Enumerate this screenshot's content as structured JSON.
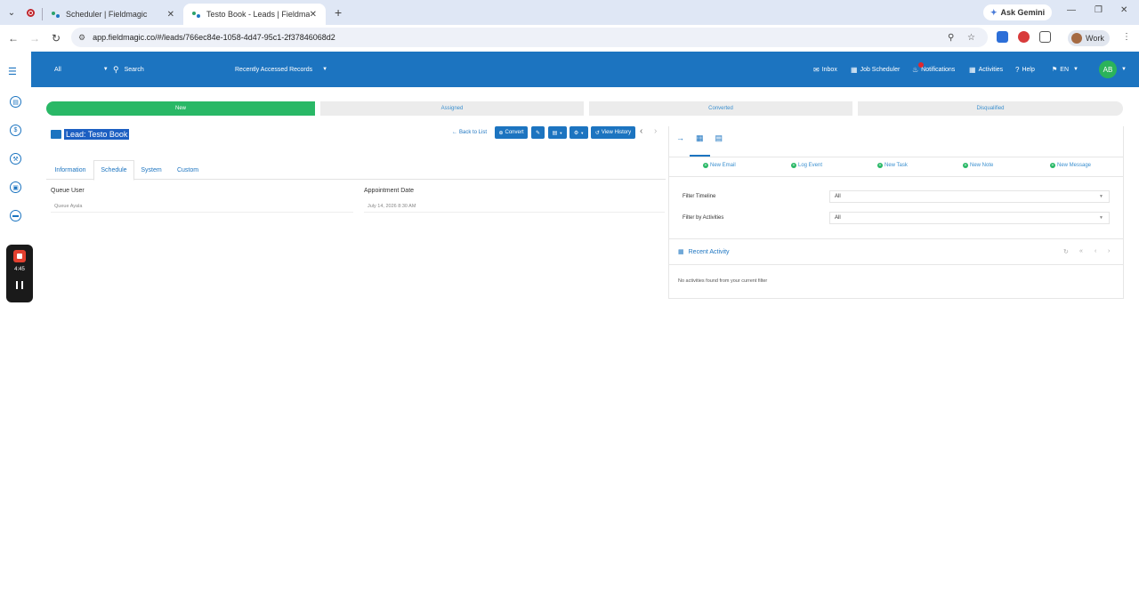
{
  "browser": {
    "tabs": [
      {
        "title": "Scheduler | Fieldmagic",
        "active": false
      },
      {
        "title": "Testo Book - Leads | Fieldmagic",
        "active": true
      }
    ],
    "new_tab": "+",
    "ask_gemini": "Ask Gemini",
    "url": "app.fieldmagic.co/#/leads/766ec84e-1058-4d47-95c1-2f37846068d2",
    "profile": "Work"
  },
  "header": {
    "scope": "All",
    "search": "Search",
    "recent_records": "Recently Accessed Records",
    "inbox": "Inbox",
    "job_scheduler": "Job Scheduler",
    "notifications": "Notifications",
    "notifications_count": "1",
    "activities": "Activities",
    "help": "Help",
    "language": "EN",
    "avatar": "AB"
  },
  "recorder": {
    "time": "4:45"
  },
  "stages": [
    "New",
    "Assigned",
    "Converted",
    "Disqualified"
  ],
  "record": {
    "title": "Lead: Testo Book",
    "back": "Back to List",
    "convert": "Convert",
    "view_history": "View History"
  },
  "record_tabs": [
    "Information",
    "Schedule",
    "System",
    "Custom"
  ],
  "fields": {
    "queue_user_label": "Queue User",
    "queue_user_value": "Queue Ayala",
    "appointment_label": "Appointment Date",
    "appointment_value": "July 14, 2026 8:30 AM"
  },
  "panel": {
    "actions": [
      "New Email",
      "Log Event",
      "New Task",
      "New Note",
      "New Message"
    ],
    "filter_timeline_label": "Filter Timeline",
    "filter_timeline_value": "All",
    "filter_activities_label": "Filter by Activities",
    "filter_activities_value": "All",
    "recent_activity": "Recent Activity",
    "empty": "No activities found from your current filter"
  },
  "colors": {
    "brand": "#1c74c0",
    "success": "#29b866"
  }
}
